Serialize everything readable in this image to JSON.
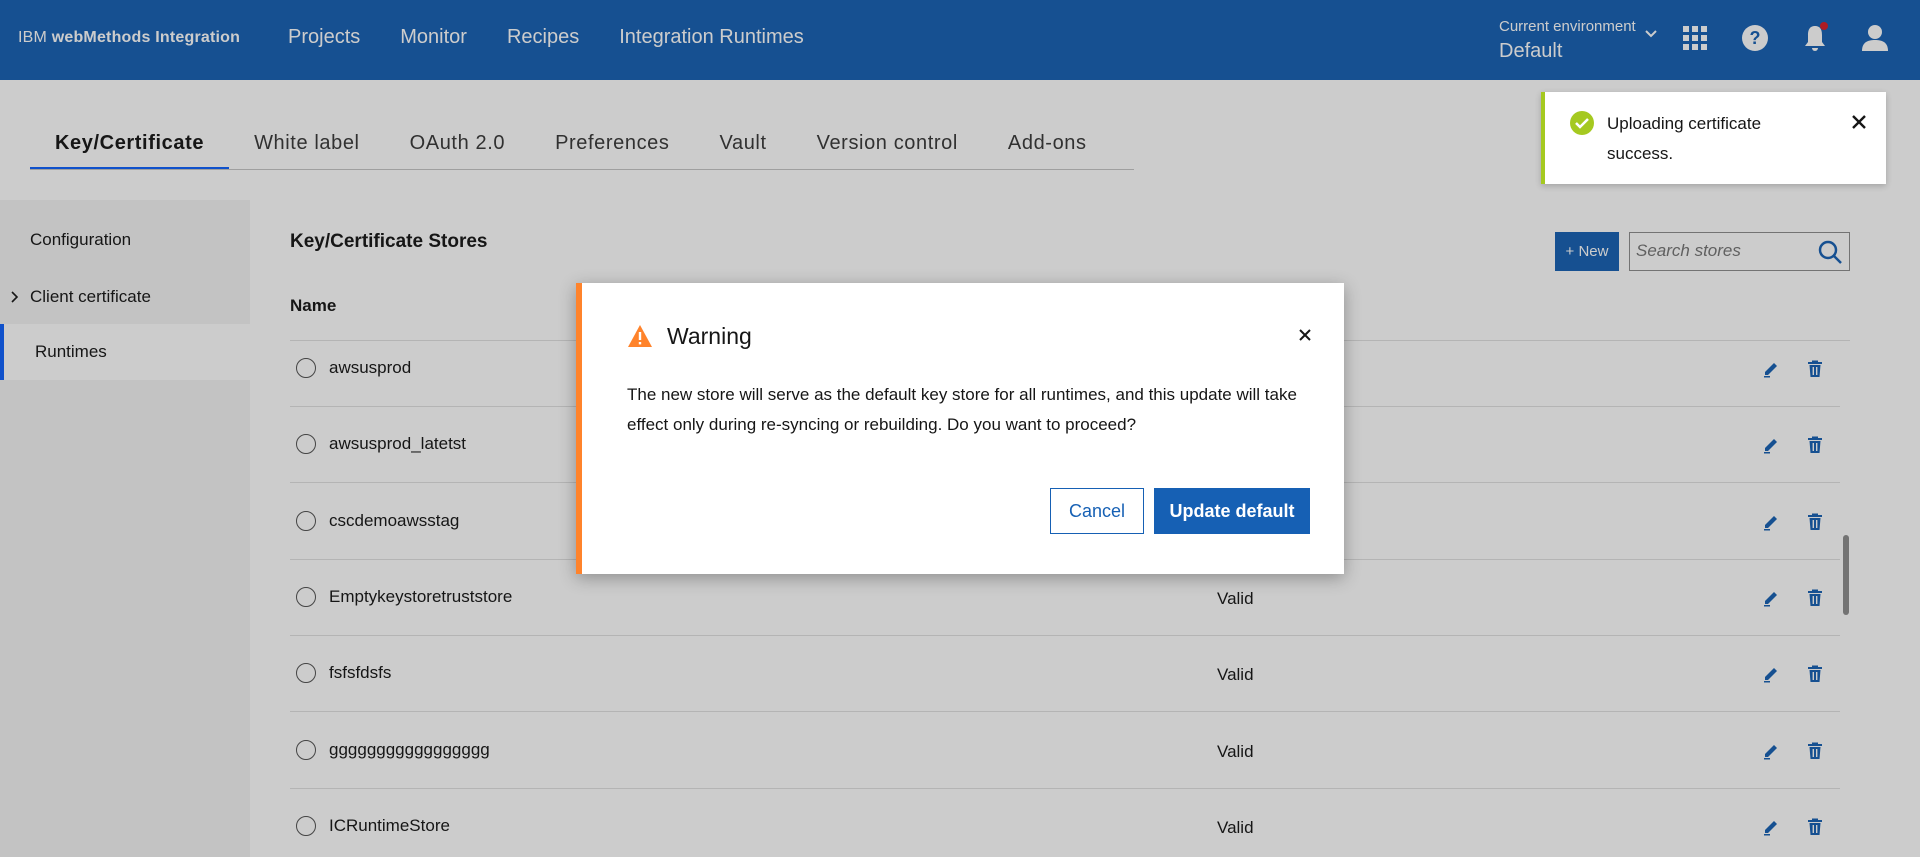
{
  "header": {
    "brand_ibm": "IBM",
    "brand_product": "webMethods Integration",
    "nav": [
      "Projects",
      "Monitor",
      "Recipes",
      "Integration Runtimes"
    ],
    "env_label": "Current environment",
    "env_value": "Default",
    "icons": [
      "app-switcher-icon",
      "help-icon",
      "notification-icon",
      "user-icon"
    ]
  },
  "tabs": [
    "Key/Certificate",
    "White label",
    "OAuth 2.0",
    "Preferences",
    "Vault",
    "Version control",
    "Add-ons"
  ],
  "sidebar": {
    "items": [
      "Configuration",
      "Client certificate",
      "Runtimes"
    ]
  },
  "main": {
    "title": "Key/Certificate Stores",
    "new_button": "+ New",
    "search_placeholder": "Search stores",
    "col_name": "Name",
    "rows": [
      {
        "name": "awsusprod",
        "status": ""
      },
      {
        "name": "awsusprod_latetst",
        "status": ""
      },
      {
        "name": "cscdemoawsstag",
        "status": ""
      },
      {
        "name": "Emptykeystoretruststore",
        "status": "Valid"
      },
      {
        "name": "fsfsfdsfs",
        "status": "Valid"
      },
      {
        "name": "ggggggggggggggggg",
        "status": "Valid"
      },
      {
        "name": "ICRuntimeStore",
        "status": "Valid"
      }
    ]
  },
  "modal": {
    "title": "Warning",
    "text": "The new store will serve as the default key store for all runtimes, and this update will take effect only during re-syncing or rebuilding. Do you want to proceed?",
    "cancel": "Cancel",
    "confirm": "Update default",
    "accent_color": "#ff832b"
  },
  "toast": {
    "text": "Uploading certificate success.",
    "accent_color": "#a5c920"
  },
  "colors": {
    "brand": "#1660b4",
    "link": "#0f62fe"
  }
}
